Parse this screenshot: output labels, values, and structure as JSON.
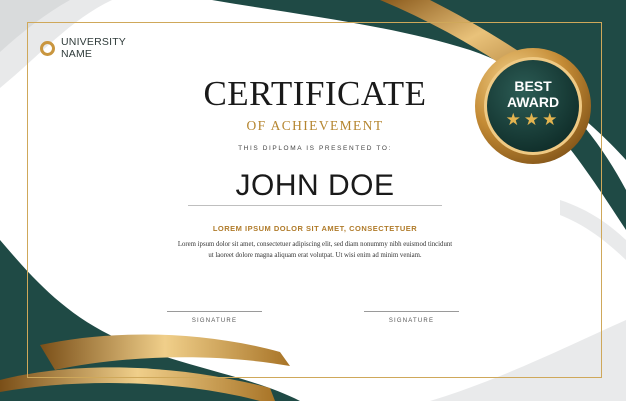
{
  "colors": {
    "green": "#1f4a45",
    "gold": "#c9963f",
    "frame": "#cfa85a"
  },
  "logo": {
    "line1": "UNIVERSITY",
    "line2": "NAME",
    "icon": "ring-icon"
  },
  "certificate": {
    "title": "CERTIFICATE",
    "subtitle": "OF ACHIEVEMENT",
    "presented_to": "THIS DIPLOMA IS PRESENTED TO:",
    "recipient": "JOHN DOE",
    "heading": "LOREM IPSUM DOLOR SIT AMET, CONSECTETUER",
    "body_line1": "Lorem ipsum dolor sit amet, consectetuer adipiscing elit, sed diam nonummy nibh euismod tincidunt",
    "body_line2": "ut laoreet dolore magna aliquam erat volutpat. Ut wisi enim ad minim veniam."
  },
  "signatures": [
    {
      "label": "SIGNATURE"
    },
    {
      "label": "SIGNATURE"
    }
  ],
  "badge": {
    "line1": "BEST",
    "line2": "AWARD",
    "stars": "★★★"
  }
}
